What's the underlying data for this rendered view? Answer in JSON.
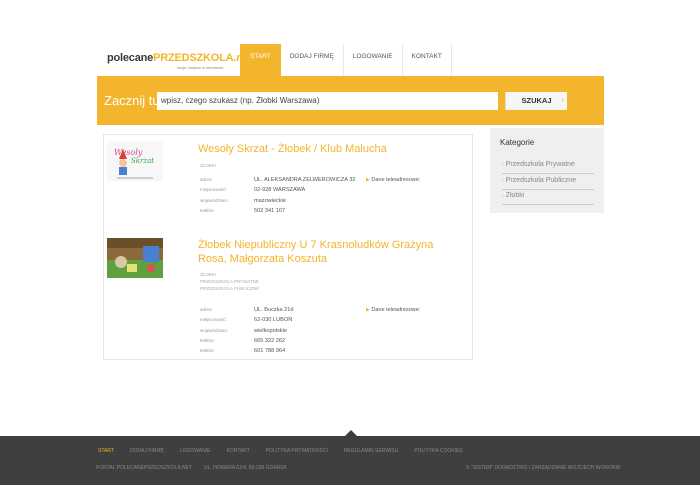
{
  "header": {
    "logo_part1": "polecane",
    "logo_part2": "PRZEDSZKOLA",
    "logo_part3": ".net",
    "logo_tagline": "twoje miejsce w internecie",
    "nav": [
      "START",
      "DODAJ FIRMĘ",
      "LOGOWANIE",
      "KONTAKT"
    ],
    "nav_active": "START"
  },
  "search": {
    "label": "Zacznij tu",
    "placeholder": "wpisz, czego szukasz (np. Żłobki Warszawa)",
    "button_label": "SZUKAJ",
    "button_arrow": "›"
  },
  "results": [
    {
      "title": "Wesoły Skrzat - Żłobek / Klub Malucha",
      "categories": [
        "ŻŁOBKI"
      ],
      "fields": [
        {
          "label": "adres:",
          "value": "UL. ALEKSANDRA ZELWEROWICZA 32"
        },
        {
          "label": "miejscowość:",
          "value": "02-928 WARSZAWA"
        },
        {
          "label": "województwo:",
          "value": "mazowieckie"
        },
        {
          "label": "telefon:",
          "value": "502 341 107"
        }
      ],
      "teleadres": "Dane teleadresowe:"
    },
    {
      "title": "Żłobek Niepubliczny U 7 Krasnoludków Grażyna Rosa, Małgorzata Koszuta",
      "categories": [
        "ŻŁOBKI",
        "PRZEDSZKOLA PRYWATNE",
        "PRZEDSZKOLA PUBLICZNE"
      ],
      "fields": [
        {
          "label": "adres:",
          "value": "UL. Buczka 21d"
        },
        {
          "label": "miejscowość:",
          "value": "62-030 LUBOŃ"
        },
        {
          "label": "województwo:",
          "value": "wielkopolskie"
        },
        {
          "label": "telefon:",
          "value": "665 322 262"
        },
        {
          "label": "telefon:",
          "value": "601 788 964"
        }
      ],
      "teleadres": "Dane teleadresowe:"
    }
  ],
  "sidebar": {
    "title": "Kategorie",
    "items": [
      "Przedszkola Prywatne",
      "Przedszkola Publiczne",
      "Żłobki"
    ]
  },
  "footer": {
    "links": [
      "START",
      "DODAJ FIRMĘ",
      "LOGOWANIE",
      "KONTAKT",
      "POLITYKA PRYWATNOŚCI",
      "REGULAMIN SERWISU",
      "POLITYKA COOKIES"
    ],
    "portal": "PORTAL POLECANEPRZEDSZKOLA.NET",
    "address": "UL. HOMERA 61/4, 80-299 GDAŃSK",
    "copyright": "© \"SISTEM\" DORADZTWO I ZARZĄDZANIE WOJCIECH WORONIN"
  },
  "colors": {
    "accent": "#f2b52d",
    "footer_bg": "#3f3f3f",
    "sidebar_bg": "#efefef"
  }
}
